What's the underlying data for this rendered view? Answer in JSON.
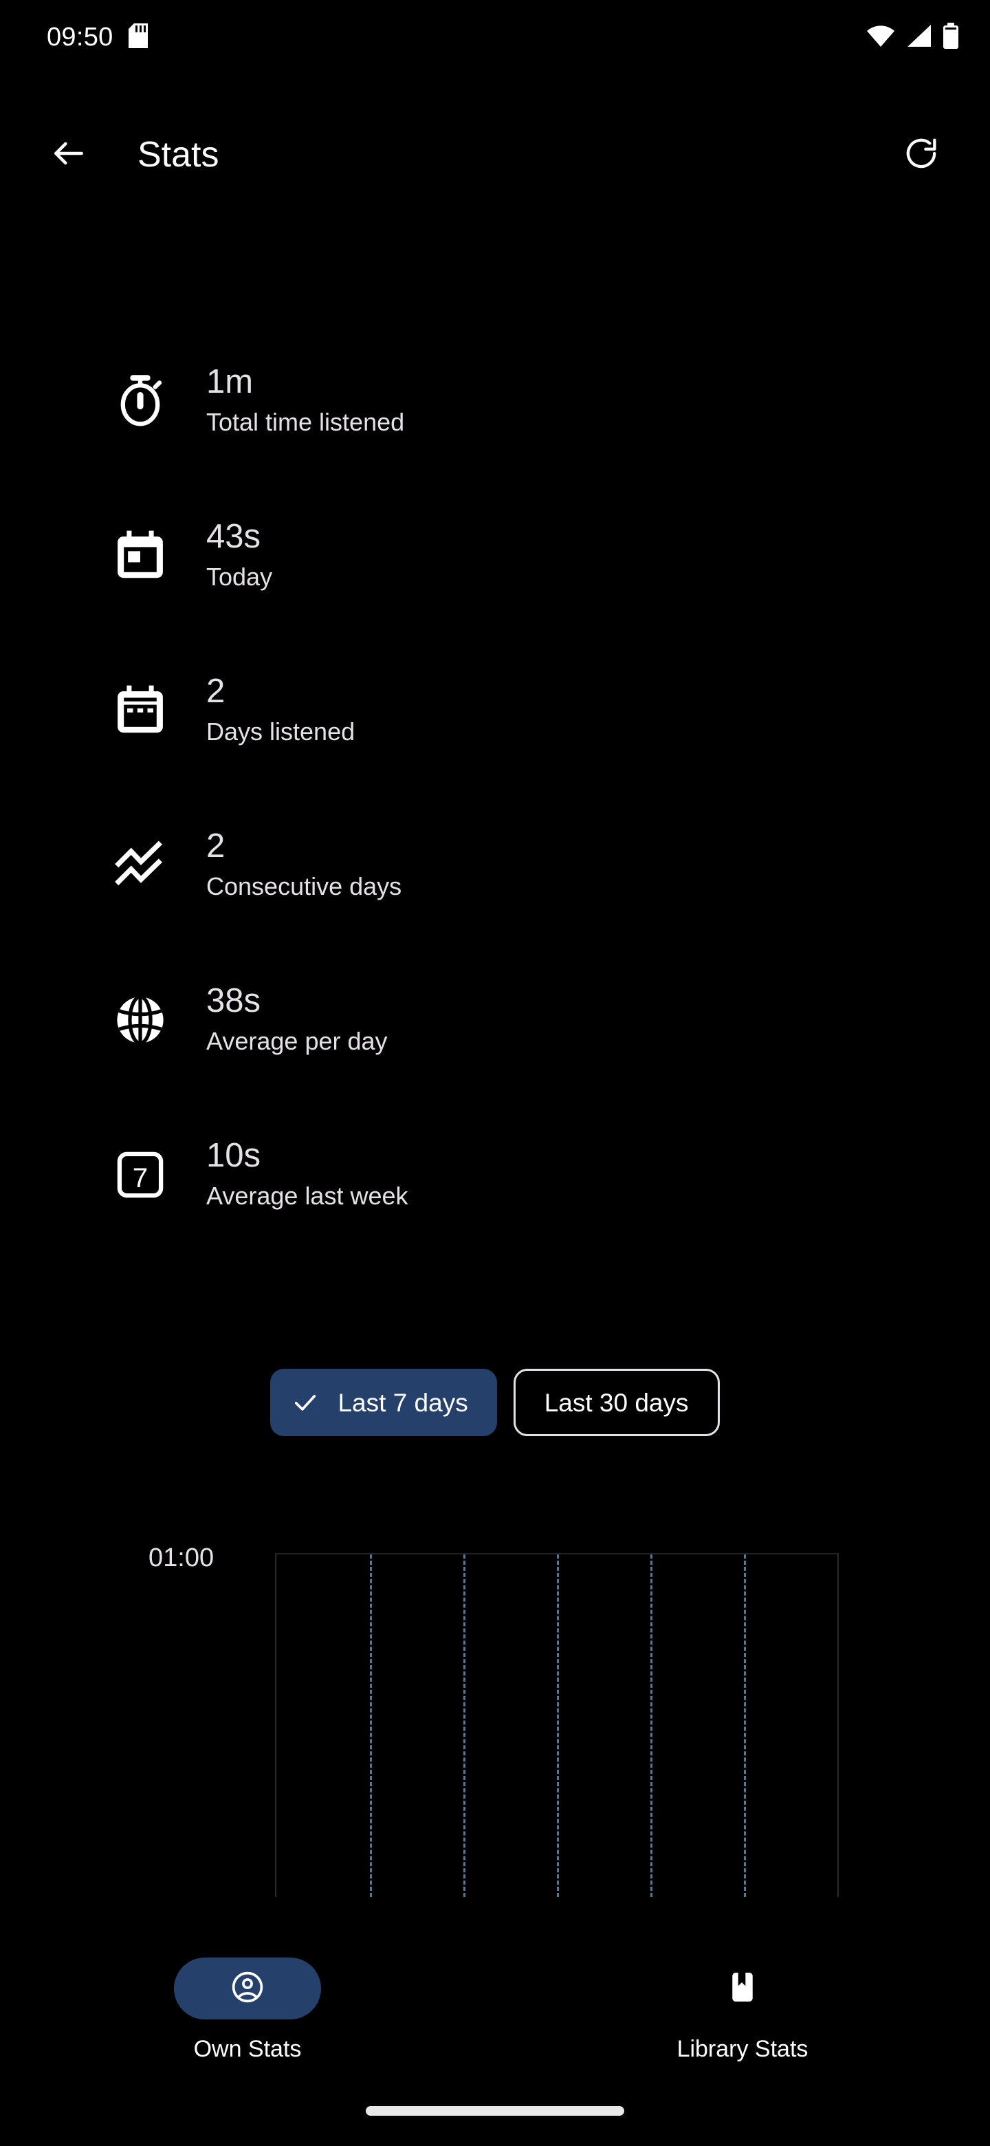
{
  "status_bar": {
    "time": "09:50",
    "icons": [
      "sd-card-icon",
      "wifi-icon",
      "cellular-signal-icon",
      "battery-icon"
    ]
  },
  "app_bar": {
    "back_icon": "back-arrow-icon",
    "title": "Stats",
    "refresh_icon": "refresh-icon"
  },
  "stats": [
    {
      "icon": "stopwatch-icon",
      "value": "1m",
      "label": "Total time listened"
    },
    {
      "icon": "calendar-today-icon",
      "value": "43s",
      "label": "Today"
    },
    {
      "icon": "calendar-days-icon",
      "value": "2",
      "label": "Days listened"
    },
    {
      "icon": "trending-lines-icon",
      "value": "2",
      "label": "Consecutive days"
    },
    {
      "icon": "globe-icon",
      "value": "38s",
      "label": "Average per day"
    },
    {
      "icon": "seven-box-icon",
      "value": "10s",
      "label": "Average last week"
    }
  ],
  "filters": {
    "chips": [
      {
        "label": "Last 7 days",
        "selected": true,
        "check_icon": "check-icon"
      },
      {
        "label": "Last 30 days",
        "selected": false
      }
    ],
    "selected_color": "#25406b"
  },
  "chart_data": {
    "type": "bar",
    "title": "",
    "xlabel": "",
    "ylabel": "",
    "y_tick_labels": [
      "01:00"
    ],
    "categories": [
      "",
      "",
      "",
      "",
      "",
      "",
      ""
    ],
    "values": [
      0,
      0,
      0,
      0,
      0,
      0,
      0
    ],
    "ylim": [
      0,
      3600
    ],
    "grid": true,
    "gridline_count": 5,
    "gridline_color": "#6d8ba6",
    "legend": "none",
    "note": "Plot area rendered empty — no bars drawn for the selected range"
  },
  "bottom_nav": {
    "items": [
      {
        "label": "Own Stats",
        "icon": "account-circle-icon",
        "active": true
      },
      {
        "label": "Library Stats",
        "icon": "bookmark-book-icon",
        "active": false
      }
    ],
    "active_pill_color": "#25406b"
  },
  "system": {
    "home_indicator": "home-indicator"
  }
}
